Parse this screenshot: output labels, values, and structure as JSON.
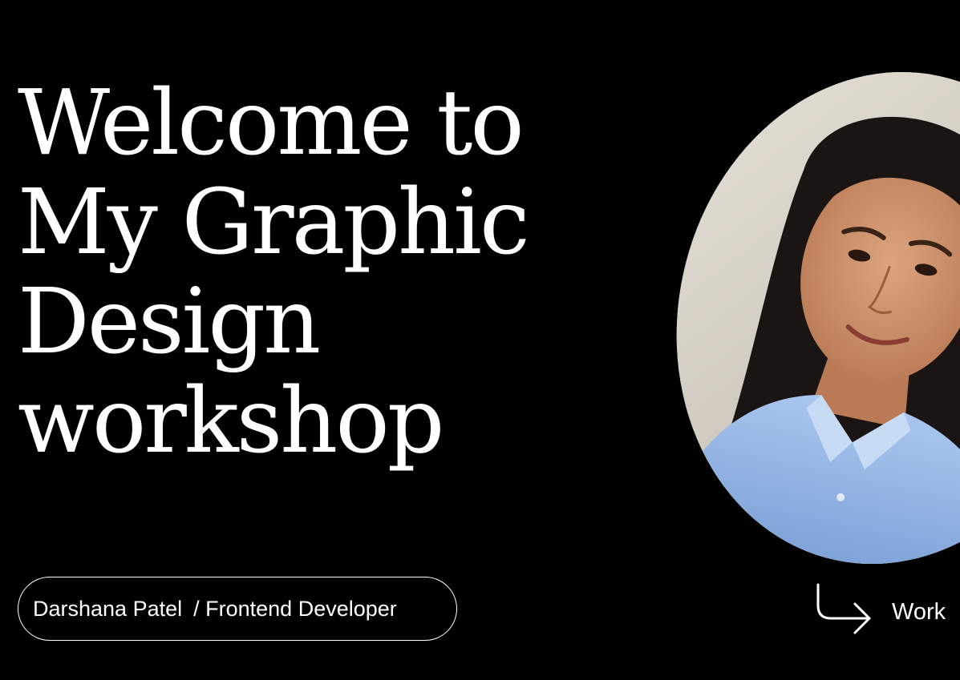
{
  "headline": {
    "line1": "Welcome to",
    "line2": "My Graphic",
    "line3": "Design",
    "line4": "workshop"
  },
  "presenter": {
    "name": "Darshana Patel",
    "role": "/ Frontend Developer"
  },
  "cta": {
    "label": "Work",
    "icon": "arrow-down-right-icon"
  },
  "colors": {
    "background": "#000000",
    "text": "#ffffff",
    "shirt": "#9cbbe8"
  }
}
